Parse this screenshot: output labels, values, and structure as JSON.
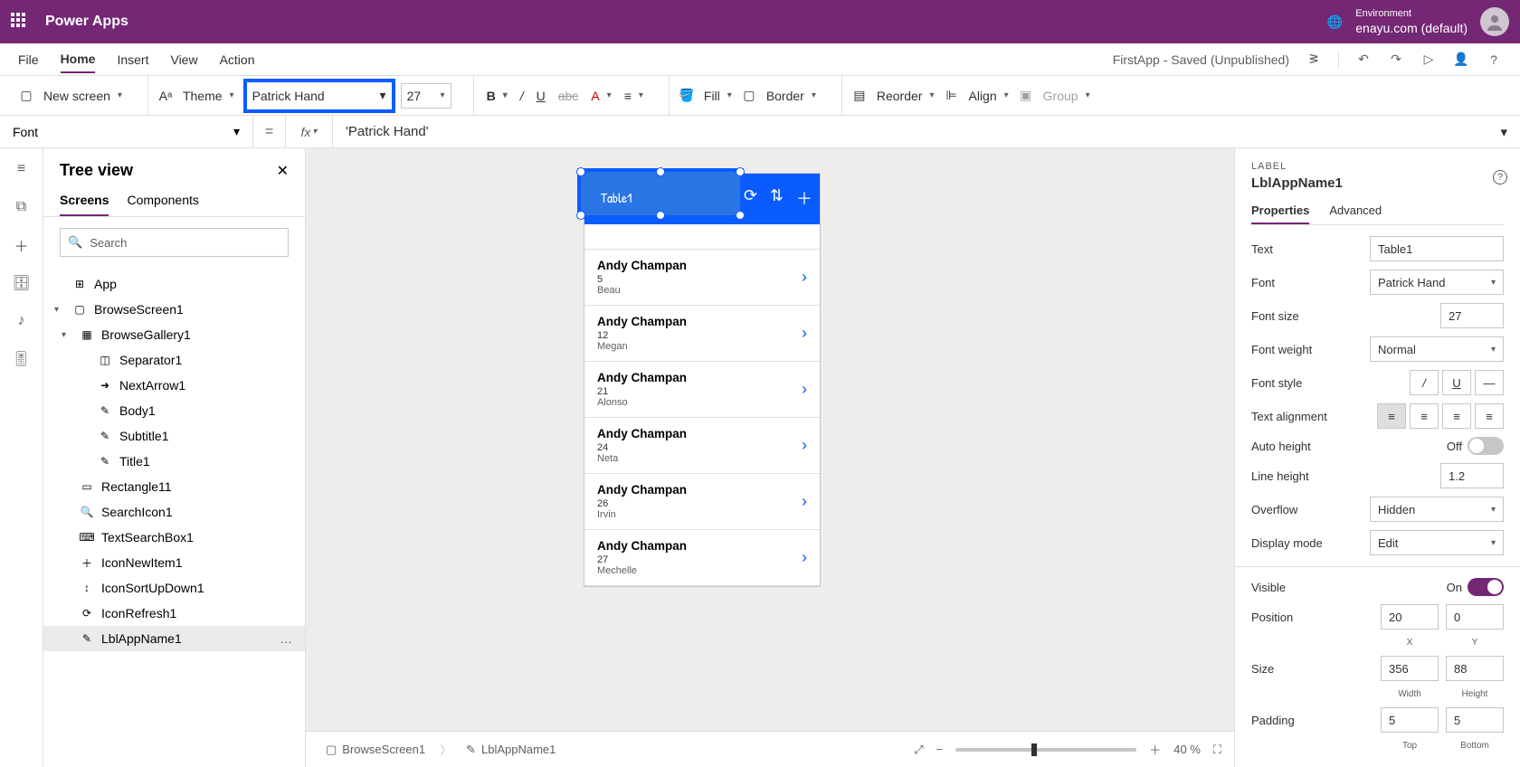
{
  "topbar": {
    "app_title": "Power Apps",
    "env_label": "Environment",
    "env_name": "enayu.com (default)"
  },
  "menubar": {
    "tabs": [
      "File",
      "Home",
      "Insert",
      "View",
      "Action"
    ],
    "active_index": 1,
    "doc_status": "FirstApp - Saved (Unpublished)"
  },
  "ribbon": {
    "new_screen": "New screen",
    "theme": "Theme",
    "font_value": "Patrick Hand",
    "size_value": "27",
    "fill": "Fill",
    "border": "Border",
    "reorder": "Reorder",
    "align": "Align",
    "group": "Group"
  },
  "fx": {
    "prop": "Font",
    "eq": "=",
    "fx": "fx",
    "value": "'Patrick Hand'"
  },
  "tree": {
    "title": "Tree view",
    "tabs": [
      "Screens",
      "Components"
    ],
    "active_index": 0,
    "search_placeholder": "Search",
    "nodes": [
      {
        "label": "App",
        "icon": "⊞",
        "indent": 0
      },
      {
        "label": "BrowseScreen1",
        "icon": "▢",
        "indent": 0,
        "exp": "▾"
      },
      {
        "label": "BrowseGallery1",
        "icon": "▦",
        "indent": 1,
        "exp": "▾"
      },
      {
        "label": "Separator1",
        "icon": "◫",
        "indent": 2
      },
      {
        "label": "NextArrow1",
        "icon": "➜",
        "indent": 2
      },
      {
        "label": "Body1",
        "icon": "✎",
        "indent": 2
      },
      {
        "label": "Subtitle1",
        "icon": "✎",
        "indent": 2
      },
      {
        "label": "Title1",
        "icon": "✎",
        "indent": 2
      },
      {
        "label": "Rectangle11",
        "icon": "▭",
        "indent": 1
      },
      {
        "label": "SearchIcon1",
        "icon": "🔍",
        "indent": 1
      },
      {
        "label": "TextSearchBox1",
        "icon": "⌨",
        "indent": 1
      },
      {
        "label": "IconNewItem1",
        "icon": "＋",
        "indent": 1
      },
      {
        "label": "IconSortUpDown1",
        "icon": "↕",
        "indent": 1
      },
      {
        "label": "IconRefresh1",
        "icon": "⟳",
        "indent": 1
      },
      {
        "label": "LblAppName1",
        "icon": "✎",
        "indent": 1,
        "sel": true,
        "dots": "…"
      }
    ]
  },
  "canvas": {
    "sel_text": "Table1",
    "items": [
      {
        "name": "Andy Champan",
        "sub": "5",
        "body": "Beau"
      },
      {
        "name": "Andy Champan",
        "sub": "12",
        "body": "Megan"
      },
      {
        "name": "Andy Champan",
        "sub": "21",
        "body": "Alonso"
      },
      {
        "name": "Andy Champan",
        "sub": "24",
        "body": "Neta"
      },
      {
        "name": "Andy Champan",
        "sub": "26",
        "body": "Irvin"
      },
      {
        "name": "Andy Champan",
        "sub": "27",
        "body": "Mechelle"
      }
    ]
  },
  "props": {
    "caption": "LABEL",
    "name": "LblAppName1",
    "tabs": [
      "Properties",
      "Advanced"
    ],
    "active_index": 0,
    "text_lbl": "Text",
    "text_val": "Table1",
    "font_lbl": "Font",
    "font_val": "Patrick Hand",
    "size_lbl": "Font size",
    "size_val": "27",
    "weight_lbl": "Font weight",
    "weight_val": "Normal",
    "style_lbl": "Font style",
    "align_lbl": "Text alignment",
    "auto_lbl": "Auto height",
    "auto_state": "Off",
    "lh_lbl": "Line height",
    "lh_val": "1.2",
    "overflow_lbl": "Overflow",
    "overflow_val": "Hidden",
    "disp_lbl": "Display mode",
    "disp_val": "Edit",
    "vis_lbl": "Visible",
    "vis_state": "On",
    "pos_lbl": "Position",
    "pos_x": "20",
    "pos_y": "0",
    "x_lbl": "X",
    "y_lbl": "Y",
    "sizep_lbl": "Size",
    "w_val": "356",
    "h_val": "88",
    "w_lbl": "Width",
    "h_lbl": "Height",
    "pad_lbl": "Padding",
    "pad_t": "5",
    "pad_b": "5",
    "t_lbl": "Top",
    "b_lbl": "Bottom"
  },
  "footer": {
    "bc1": "BrowseScreen1",
    "bc2": "LblAppName1",
    "zoom": "40",
    "pct": "%"
  }
}
